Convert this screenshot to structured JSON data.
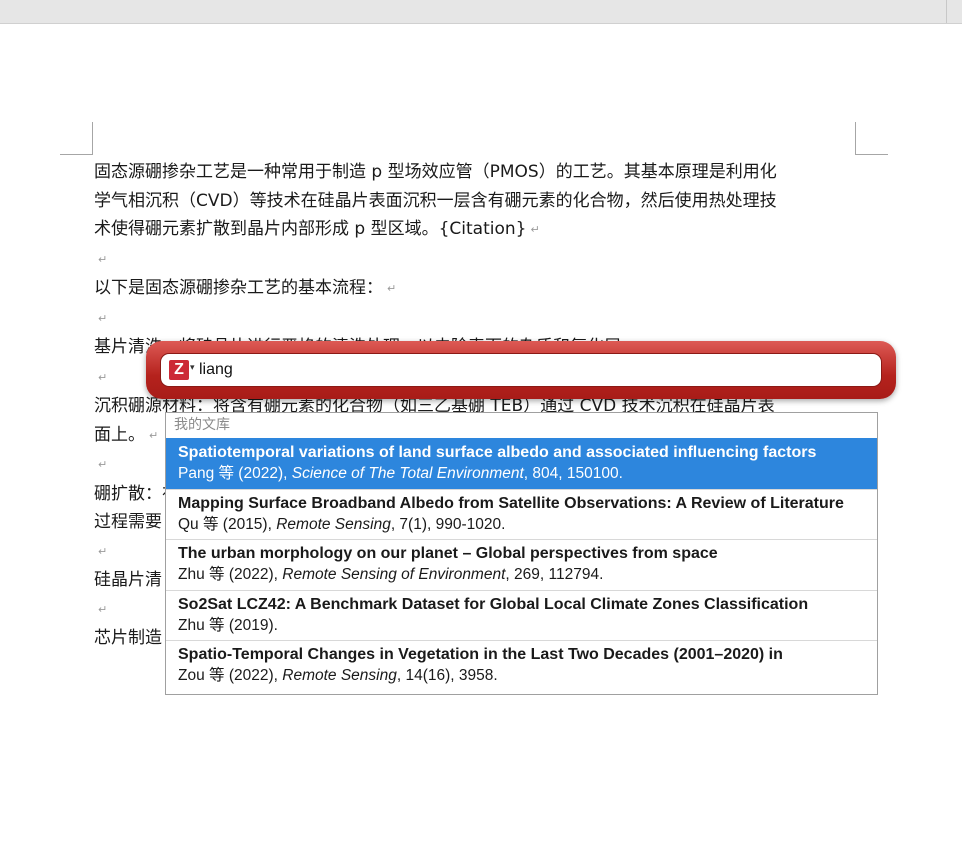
{
  "document": {
    "paragraphs": [
      {
        "text": "固态源硼掺杂工艺是一种常用于制造 p 型场效应管（PMOS）的工艺。其基本原理是利用化",
        "mark": false
      },
      {
        "text": "学气相沉积（CVD）等技术在硅晶片表面沉积一层含有硼元素的化合物，然后使用热处理技",
        "mark": false
      },
      {
        "text": "术使得硼元素扩散到晶片内部形成 p 型区域。{Citation}",
        "mark": true
      },
      {
        "text": "",
        "mark": true
      },
      {
        "text": "以下是固态源硼掺杂工艺的基本流程：",
        "mark": true
      },
      {
        "text": "",
        "mark": true
      },
      {
        "text": "基片清洗：将硅晶片进行严格的清洗处理，以去除表面的杂质和氧化层。",
        "mark": true
      },
      {
        "text": "",
        "mark": true
      },
      {
        "text": "沉积硼源材料：将含有硼元素的化合物（如三乙基硼 TEB）通过 CVD 技术沉积在硅晶片表",
        "mark": false
      },
      {
        "text": "面上。",
        "mark": true
      },
      {
        "text": "",
        "mark": true
      },
      {
        "text": "硼扩散：在高温下，将硅晶片进行热处理，使得硼元素扩散到晶片内部形成 p 型区域。硼扩散的",
        "mark": false
      },
      {
        "text": "过程需要",
        "mark": false
      },
      {
        "text": "",
        "mark": true
      },
      {
        "text": "硅晶片清",
        "mark": false
      },
      {
        "text": "",
        "mark": true
      },
      {
        "text": "芯片制造：利用制造技术制造 PMOS 晶体管。",
        "mark": true
      }
    ],
    "paragraph_mark": "↵"
  },
  "quick_format": {
    "logo": "Z",
    "logo_icon": "zotero-logo-icon",
    "dropdown_glyph": "▾",
    "search_value": "liang"
  },
  "results": {
    "section_label": "我的文库",
    "items": [
      {
        "title": "Spatiotemporal variations of land surface albedo and associated influencing factors",
        "author": "Pang 等 (2022), ",
        "journal": "Science of The Total Environment",
        "details": ", 804, 150100."
      },
      {
        "title": "Mapping Surface Broadband Albedo from Satellite Observations: A Review of Literature",
        "author": "Qu 等 (2015), ",
        "journal": "Remote Sensing",
        "details": ", 7(1), 990-1020."
      },
      {
        "title": "The urban morphology on our planet – Global perspectives from space",
        "author": "Zhu 等 (2022), ",
        "journal": "Remote Sensing of Environment",
        "details": ", 269, 112794."
      },
      {
        "title": "So2Sat LCZ42: A Benchmark Dataset for Global Local Climate Zones Classification",
        "author": "Zhu 等 (2019).",
        "journal": "",
        "details": ""
      },
      {
        "title": "Spatio-Temporal Changes in Vegetation in the Last Two Decades (2001–2020) in",
        "author": "Zou 等 (2022), ",
        "journal": "Remote Sensing",
        "details": ", 14(16), 3958."
      }
    ]
  },
  "colors": {
    "selection": "#2d86dd",
    "zotero_red": "#cc2936",
    "bar_red": "#b5221d"
  }
}
